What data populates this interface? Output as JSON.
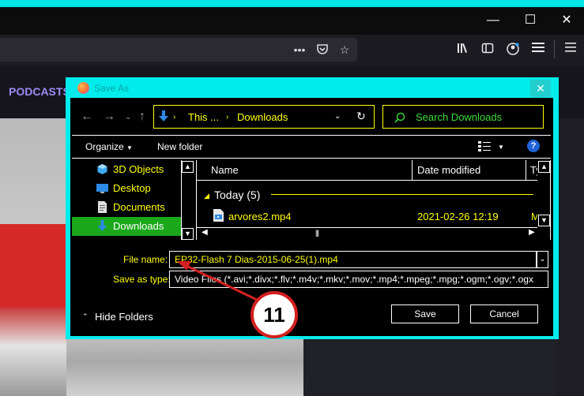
{
  "browser": {
    "page_nav_label": "PODCASTS",
    "window_controls": {
      "minimize": "—",
      "maximize": "☐",
      "close": "✕"
    }
  },
  "dialog": {
    "title": "Save As",
    "close_glyph": "✕",
    "breadcrumb": {
      "root": "This ...",
      "current": "Downloads"
    },
    "search_placeholder": "Search Downloads",
    "toolbar": {
      "organize": "Organize",
      "new_folder": "New folder"
    },
    "tree": [
      {
        "label": "3D Objects",
        "icon": "3d-objects-icon",
        "color": "#3fa9f5"
      },
      {
        "label": "Desktop",
        "icon": "desktop-icon",
        "color": "#2d8ae6"
      },
      {
        "label": "Documents",
        "icon": "documents-icon",
        "color": "#e0e0e0"
      },
      {
        "label": "Downloads",
        "icon": "downloads-icon",
        "color": "#2d8ae6",
        "selected": true
      }
    ],
    "columns": {
      "name": "Name",
      "date_modified": "Date modified",
      "type": "Ty"
    },
    "group": {
      "label": "Today (5)"
    },
    "files": [
      {
        "name": "arvores2.mp4",
        "date": "2021-02-26 12:19",
        "type": "M"
      }
    ],
    "file_name_label": "File name:",
    "file_name_value": "EP32-Flash 7 Dias-2015-06-25(1).mp4",
    "save_type_label": "Save as type:",
    "save_type_value": "Video Files (*.avi;*.divx;*.flv;*.m4v;*.mkv;*.mov;*.mp4;*.mpeg;*.mpg;*.ogm;*.ogv;*.ogx",
    "hide_folders": "Hide Folders",
    "save_button": "Save",
    "cancel_button": "Cancel"
  },
  "annotation": {
    "number": "11",
    "color": "#d42020"
  },
  "colors": {
    "accent": "#00ecec",
    "highlight_text": "#ffff00",
    "selection": "#1aa81a",
    "search_text": "#3dde3d"
  }
}
